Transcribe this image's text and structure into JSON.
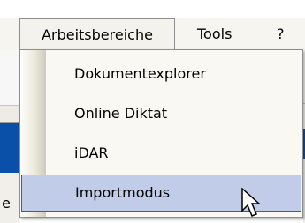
{
  "menubar": {
    "items": [
      {
        "label": "Arbeitsbereiche"
      },
      {
        "label": "Tools"
      },
      {
        "label": "?"
      }
    ]
  },
  "dropdown": {
    "items": [
      {
        "label": "Dokumentexplorer"
      },
      {
        "label": "Online Diktat"
      },
      {
        "label": "iDAR"
      },
      {
        "label": "Importmodus",
        "highlighted": true
      }
    ]
  },
  "background": {
    "partial_text": "e"
  },
  "colors": {
    "menu_background": "#f6f5ef",
    "highlight_fill": "#c0cce8",
    "highlight_border": "#415b90",
    "title_bar_blue": "#0a4fa8"
  },
  "cursor": {
    "type": "arrow-pointer"
  }
}
